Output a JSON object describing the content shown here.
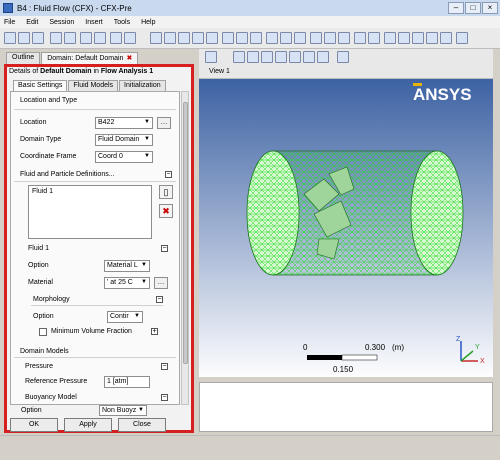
{
  "window": {
    "title": "B4 : Fluid Flow (CFX) - CFX-Pre"
  },
  "menu": [
    "File",
    "Edit",
    "Session",
    "Insert",
    "Tools",
    "Help"
  ],
  "tabs": {
    "outline": "Outline",
    "domain": "Domain: Default Domain"
  },
  "details": {
    "prefix": "Details of",
    "object": "Default Domain",
    "in_text": "in",
    "analysis": "Flow Analysis 1"
  },
  "subtabs": [
    "Basic Settings",
    "Fluid Models",
    "Initialization"
  ],
  "form": {
    "location_and_type": "Location and Type",
    "location_label": "Location",
    "location_value": "B422",
    "domain_type_label": "Domain Type",
    "domain_type_value": "Fluid Domain",
    "coord_frame_label": "Coordinate Frame",
    "coord_frame_value": "Coord 0",
    "fluid_defs_label": "Fluid and Particle Definitions...",
    "fluid_list": [
      "Fluid 1"
    ],
    "fluid1_header": "Fluid 1",
    "option_label": "Option",
    "option_value": "Material L",
    "material_label": "Material",
    "material_value": "' at 25 C",
    "morphology_label": "Morphology",
    "morph_option_label": "Option",
    "morph_option_value": "Contir",
    "min_vol_frac_label": "Minimum Volume Fraction",
    "domain_models_label": "Domain Models",
    "pressure_label": "Pressure",
    "ref_pressure_label": "Reference Pressure",
    "ref_pressure_value": "1 [atm]",
    "buoyancy_label": "Buoyancy Model",
    "buoy_option_label": "Option",
    "buoy_option_value": "Non Buoyz"
  },
  "buttons": {
    "ok": "OK",
    "apply": "Apply",
    "close": "Close"
  },
  "view": {
    "label": "View 1",
    "brand": "ANSYS",
    "scale_min": "0",
    "scale_mid": "0.300",
    "scale_unit": "(m)",
    "scale_sub": "0.150",
    "axis_z": "Z",
    "axis_x": "X",
    "axis_y": "Y"
  },
  "colors": {
    "mesh": "#22dd22",
    "highlight": "#d62020",
    "brand_yellow": "#e8b400"
  }
}
